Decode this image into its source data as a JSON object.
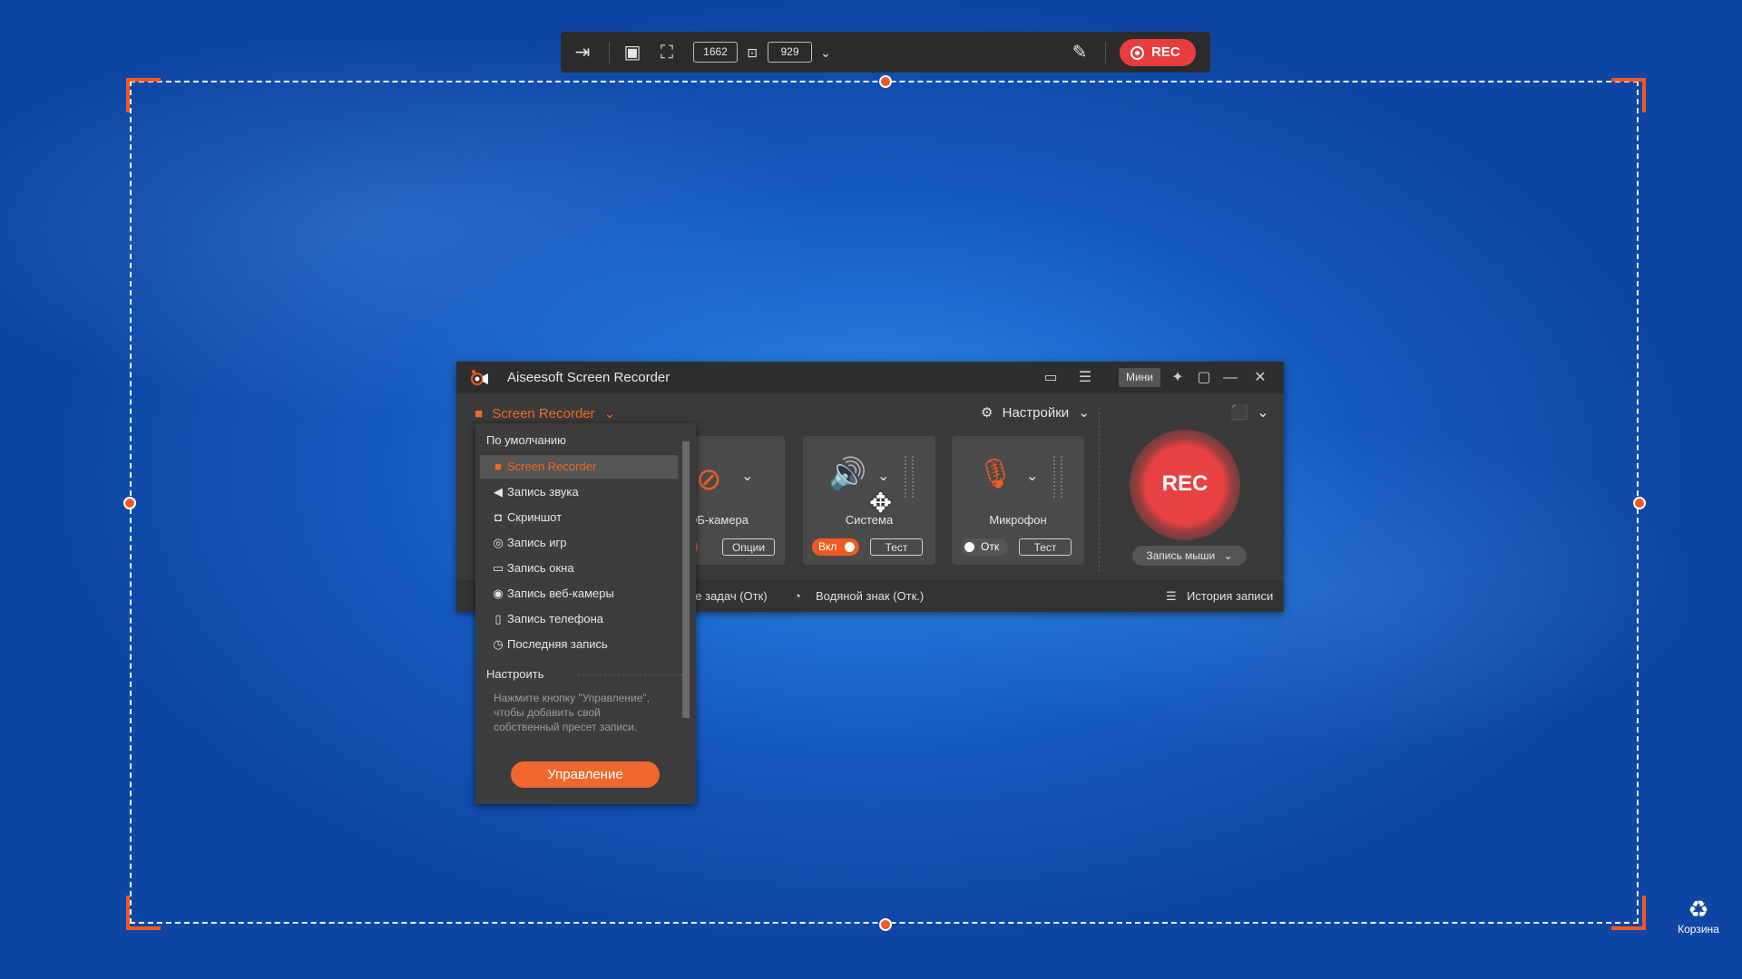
{
  "toolbar": {
    "width_value": "1662",
    "height_value": "929",
    "rec_label": "REC"
  },
  "window": {
    "title": "Aiseesoft Screen Recorder",
    "mini_label": "Мини",
    "mode_label": "Screen Recorder",
    "settings_label": "Настройки",
    "webcam": {
      "label": "ЭБ-камера",
      "toggle": "к",
      "options": "Опции"
    },
    "system": {
      "label": "Система",
      "toggle": "Вкл",
      "test": "Тест"
    },
    "mic": {
      "label": "Микрофон",
      "toggle": "Отк",
      "test": "Тест"
    },
    "rec_label": "REC",
    "mouse_rec_label": "Запись мыши",
    "bottom": {
      "tasks": "ие задач (Отк)",
      "watermark": "Водяной знак (Отк.)",
      "history": "История записи"
    }
  },
  "dropdown": {
    "default_header": "По умолчанию",
    "items": [
      {
        "label": "Screen Recorder",
        "icon": "video-camera-icon"
      },
      {
        "label": "Запись звука",
        "icon": "speaker-icon"
      },
      {
        "label": "Скриншот",
        "icon": "camera-icon"
      },
      {
        "label": "Запись игр",
        "icon": "gamepad-icon"
      },
      {
        "label": "Запись окна",
        "icon": "window-icon"
      },
      {
        "label": "Запись веб-камеры",
        "icon": "webcam-icon"
      },
      {
        "label": "Запись телефона",
        "icon": "phone-icon"
      },
      {
        "label": "Последняя запись",
        "icon": "clock-icon"
      }
    ],
    "custom_header": "Настроить",
    "hint": "Нажмите кнопку \"Управление\", чтобы добавить свой собственный пресет записи.",
    "manage_button": "Управление"
  },
  "desktop": {
    "recycle_bin_label": "Корзина"
  },
  "colors": {
    "accent": "#f05a22",
    "rec_red": "#e84141",
    "window_bg": "#3a3a3a"
  }
}
